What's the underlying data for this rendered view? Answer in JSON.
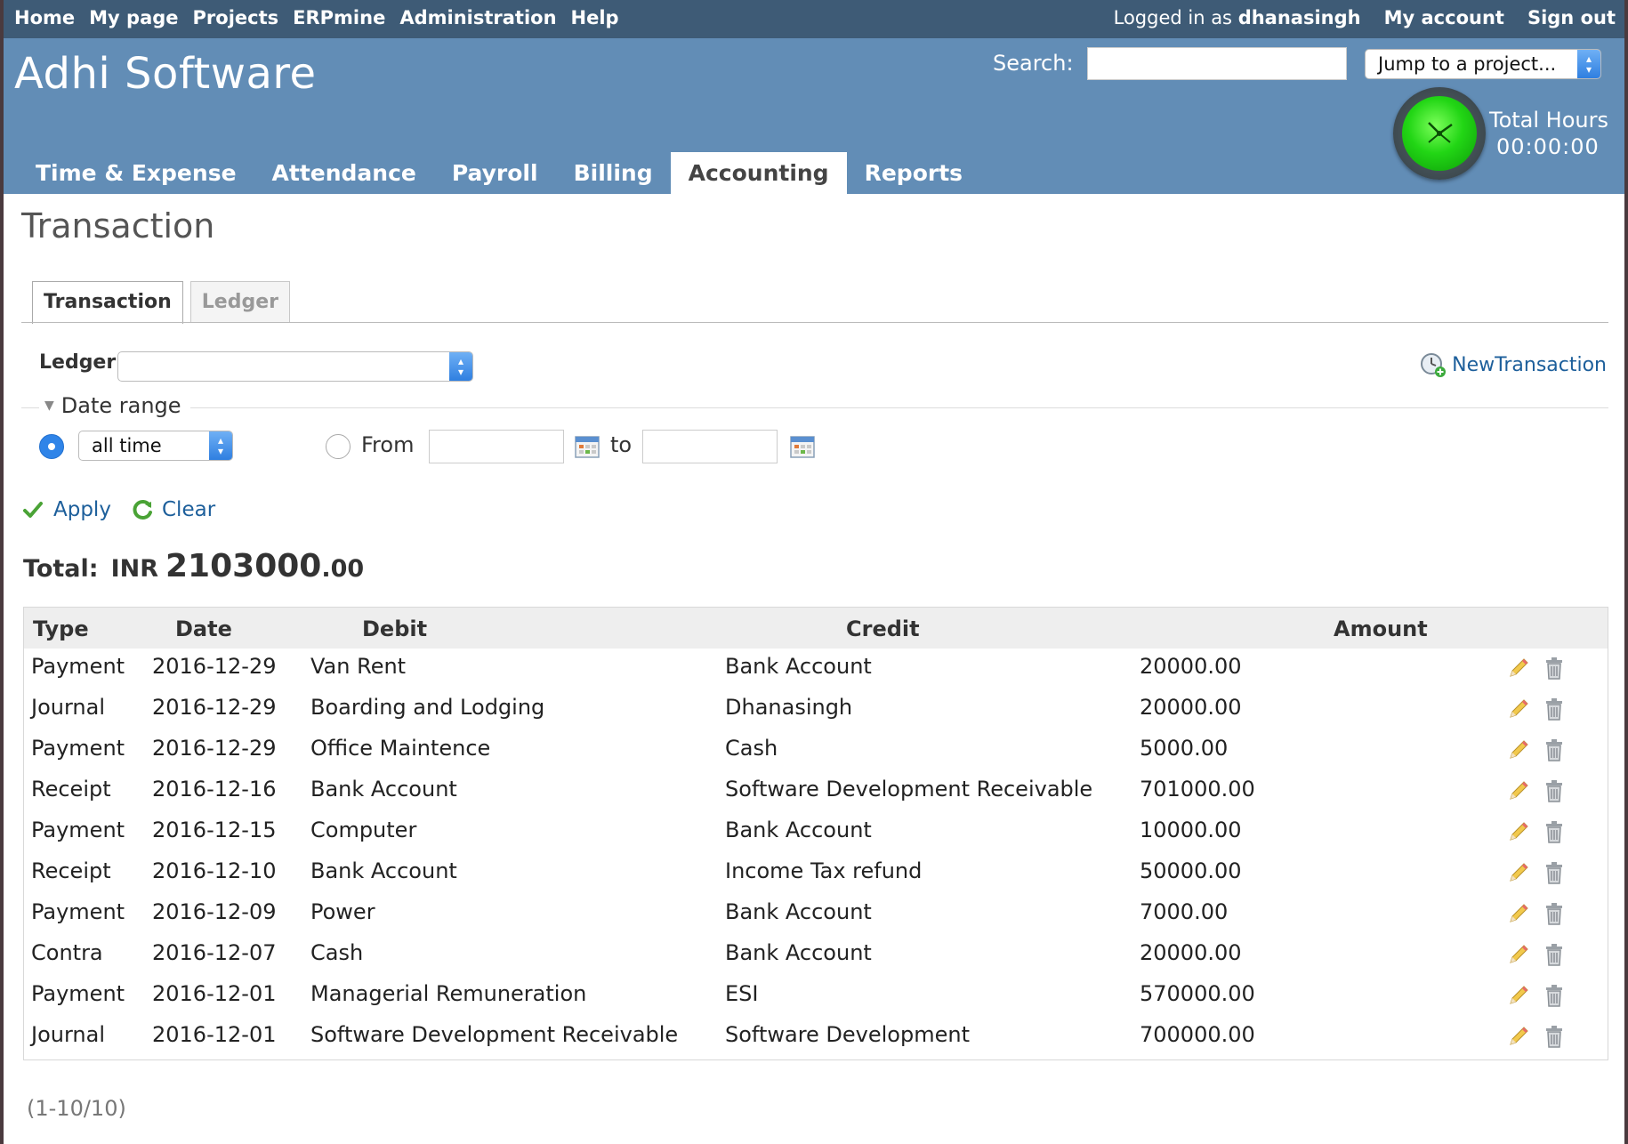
{
  "top_menu": {
    "items": [
      "Home",
      "My page",
      "Projects",
      "ERPmine",
      "Administration",
      "Help"
    ],
    "logged_in_prefix": "Logged in as",
    "username": "dhanasingh",
    "my_account": "My account",
    "sign_out": "Sign out"
  },
  "header": {
    "app_title": "Adhi Software",
    "search_label": "Search:",
    "search_value": "",
    "jump_select": "Jump to a project...",
    "total_hours_label": "Total Hours",
    "total_hours_value": "00:00:00"
  },
  "main_tabs": [
    {
      "label": "Time & Expense",
      "active": false
    },
    {
      "label": "Attendance",
      "active": false
    },
    {
      "label": "Payroll",
      "active": false
    },
    {
      "label": "Billing",
      "active": false
    },
    {
      "label": "Accounting",
      "active": true
    },
    {
      "label": "Reports",
      "active": false
    }
  ],
  "page_title": "Transaction",
  "sub_tabs": [
    {
      "label": "Transaction",
      "active": true
    },
    {
      "label": "Ledger",
      "active": false
    }
  ],
  "filters": {
    "ledger_label": "Ledger",
    "ledger_value": "",
    "new_transaction": "NewTransaction",
    "date_range_legend": "Date range",
    "period_value": "all time",
    "from_label": "From",
    "to_label": "to",
    "from_value": "",
    "to_value": "",
    "apply": "Apply",
    "clear": "Clear"
  },
  "total": {
    "label": "Total:",
    "currency": "INR",
    "amount_main": "2103000",
    "amount_cents": ".00"
  },
  "table": {
    "headers": {
      "type": "Type",
      "date": "Date",
      "debit": "Debit",
      "credit": "Credit",
      "amount": "Amount"
    },
    "rows": [
      {
        "type": "Payment",
        "date": "2016-12-29",
        "debit": "Van Rent",
        "credit": "Bank Account",
        "amount": "20000.00"
      },
      {
        "type": "Journal",
        "date": "2016-12-29",
        "debit": "Boarding and Lodging",
        "credit": "Dhanasingh",
        "amount": "20000.00"
      },
      {
        "type": "Payment",
        "date": "2016-12-29",
        "debit": "Office Maintence",
        "credit": "Cash",
        "amount": "5000.00"
      },
      {
        "type": "Receipt",
        "date": "2016-12-16",
        "debit": "Bank Account",
        "credit": "Software Development Receivable",
        "amount": "701000.00"
      },
      {
        "type": "Payment",
        "date": "2016-12-15",
        "debit": "Computer",
        "credit": "Bank Account",
        "amount": "10000.00"
      },
      {
        "type": "Receipt",
        "date": "2016-12-10",
        "debit": "Bank Account",
        "credit": "Income Tax refund",
        "amount": "50000.00"
      },
      {
        "type": "Payment",
        "date": "2016-12-09",
        "debit": "Power",
        "credit": "Bank Account",
        "amount": "7000.00"
      },
      {
        "type": "Contra",
        "date": "2016-12-07",
        "debit": "Cash",
        "credit": "Bank Account",
        "amount": "20000.00"
      },
      {
        "type": "Payment",
        "date": "2016-12-01",
        "debit": "Managerial Remuneration",
        "credit": "ESI",
        "amount": "570000.00"
      },
      {
        "type": "Journal",
        "date": "2016-12-01",
        "debit": "Software Development Receivable",
        "credit": "Software Development",
        "amount": "700000.00"
      }
    ]
  },
  "pagination": "(1-10/10)",
  "colors": {
    "top_menu_bg": "#3e5b76",
    "header_bg": "#628db6",
    "link": "#1d5f9b"
  },
  "icons": {
    "row_edit": "pencil-icon",
    "row_delete": "trash-icon",
    "apply": "checkmark-icon",
    "clear": "refresh-icon",
    "new_transaction": "add-clock-icon",
    "calendar": "calendar-icon",
    "timer": "green-clock-icon"
  }
}
